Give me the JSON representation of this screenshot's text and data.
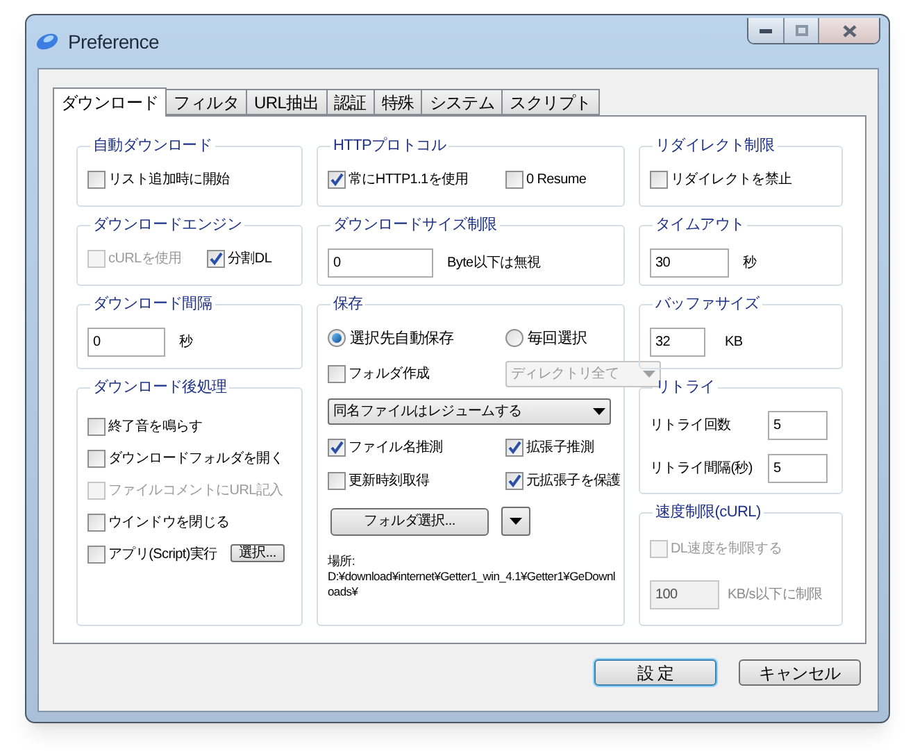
{
  "window": {
    "title": "Preference"
  },
  "tabs": [
    {
      "label": "ダウンロード",
      "selected": true
    },
    {
      "label": "フィルタ",
      "selected": false
    },
    {
      "label": "URL抽出",
      "selected": false
    },
    {
      "label": "認証",
      "selected": false
    },
    {
      "label": "特殊",
      "selected": false
    },
    {
      "label": "システム",
      "selected": false
    },
    {
      "label": "スクリプト",
      "selected": false
    }
  ],
  "columns": [
    [
      {
        "title": "自動ダウンロード",
        "rows": [
          [
            {
              "kind": "checkbox",
              "label": "リスト追加時に開始",
              "checked": false,
              "disabled": false
            }
          ]
        ]
      },
      {
        "title": "ダウンロードエンジン",
        "rows": [
          [
            {
              "kind": "checkbox",
              "label": "cURLを使用",
              "checked": false,
              "disabled": true
            },
            {
              "kind": "checkbox",
              "label": "分割DL",
              "checked": true,
              "disabled": false
            }
          ]
        ]
      },
      {
        "title": "ダウンロード間隔",
        "rows": [
          [
            {
              "kind": "field",
              "value": "0",
              "disabled": false
            },
            {
              "kind": "text",
              "text": "秒",
              "disabled": false
            }
          ]
        ]
      },
      {
        "title": "ダウンロード後処理",
        "rows": [
          [
            {
              "kind": "checkbox",
              "label": "終了音を鳴らす",
              "checked": false,
              "disabled": false
            }
          ],
          [
            {
              "kind": "checkbox",
              "label": "ダウンロードフォルダを開く",
              "checked": false,
              "disabled": false
            }
          ],
          [
            {
              "kind": "checkbox",
              "label": "ファイルコメントにURL記入",
              "checked": false,
              "disabled": true
            }
          ],
          [
            {
              "kind": "checkbox",
              "label": "ウインドウを閉じる",
              "checked": false,
              "disabled": false
            }
          ],
          [
            {
              "kind": "checkbox",
              "label": "アプリ(Script)実行",
              "checked": false,
              "disabled": false
            },
            {
              "kind": "small_button",
              "label": "選択..."
            }
          ]
        ]
      }
    ],
    [
      {
        "title": "HTTPプロトコル",
        "rows": [
          [
            {
              "kind": "checkbox",
              "label": "常にHTTP1.1を使用",
              "checked": true,
              "disabled": false
            },
            {
              "kind": "checkbox",
              "label": "0 Resume",
              "checked": false,
              "disabled": false
            }
          ]
        ]
      },
      {
        "title": "ダウンロードサイズ制限",
        "rows": [
          [
            {
              "kind": "field",
              "value": "0",
              "disabled": false
            },
            {
              "kind": "text",
              "text": "Byte以下は無視",
              "disabled": false
            }
          ]
        ]
      },
      {
        "title": "保存",
        "rows": [
          [
            {
              "kind": "radio",
              "label": "選択先自動保存",
              "selected": true
            },
            {
              "kind": "radio",
              "label": "毎回選択",
              "selected": false
            }
          ],
          [
            {
              "kind": "checkbox",
              "label": "フォルダ作成",
              "checked": false,
              "disabled": false
            },
            {
              "kind": "dropdown",
              "value": "ディレクトリ全て",
              "disabled": true
            }
          ],
          [
            {
              "kind": "dropdown",
              "value": "同名ファイルはレジュームする",
              "disabled": false
            }
          ],
          [
            {
              "kind": "checkbox",
              "label": "ファイル名推測",
              "checked": true,
              "disabled": false
            },
            {
              "kind": "checkbox",
              "label": "拡張子推測",
              "checked": true,
              "disabled": false
            }
          ],
          [
            {
              "kind": "checkbox",
              "label": "更新時刻取得",
              "checked": false,
              "disabled": false
            },
            {
              "kind": "checkbox",
              "label": "元拡張子を保護",
              "checked": true,
              "disabled": false
            }
          ],
          [
            {
              "kind": "button",
              "label": "フォルダ選択..."
            },
            {
              "kind": "arrow_button"
            }
          ],
          [
            {
              "kind": "path",
              "label": "場所:",
              "text": "D:¥download¥internet¥Getter1_win_4.1¥Getter1¥GeDownloads¥"
            }
          ]
        ]
      }
    ],
    [
      {
        "title": "リダイレクト制限",
        "rows": [
          [
            {
              "kind": "checkbox",
              "label": "リダイレクトを禁止",
              "checked": false,
              "disabled": false
            }
          ]
        ]
      },
      {
        "title": "タイムアウト",
        "rows": [
          [
            {
              "kind": "field",
              "value": "30",
              "disabled": false
            },
            {
              "kind": "text",
              "text": "秒",
              "disabled": false
            }
          ]
        ]
      },
      {
        "title": "バッファサイズ",
        "rows": [
          [
            {
              "kind": "field",
              "value": "32",
              "disabled": false
            },
            {
              "kind": "text",
              "text": "KB",
              "disabled": false
            }
          ]
        ]
      },
      {
        "title": "リトライ",
        "rows": [
          [
            {
              "kind": "text",
              "text": "リトライ回数",
              "disabled": false
            },
            {
              "kind": "field",
              "value": "5",
              "disabled": false
            }
          ],
          [
            {
              "kind": "text",
              "text": "リトライ間隔(秒)",
              "disabled": false
            },
            {
              "kind": "field",
              "value": "5",
              "disabled": false
            }
          ]
        ]
      },
      {
        "title": "速度制限(cURL)",
        "rows": [
          [
            {
              "kind": "checkbox",
              "label": "DL速度を制限する",
              "checked": false,
              "disabled": true
            }
          ],
          [
            {
              "kind": "field",
              "value": "100",
              "disabled": true
            },
            {
              "kind": "text",
              "text": "KB/s以下に制限",
              "disabled": true
            }
          ]
        ]
      }
    ]
  ],
  "buttons": [
    {
      "label": "設 定",
      "default": true
    },
    {
      "label": "キャンセル",
      "default": false
    }
  ]
}
